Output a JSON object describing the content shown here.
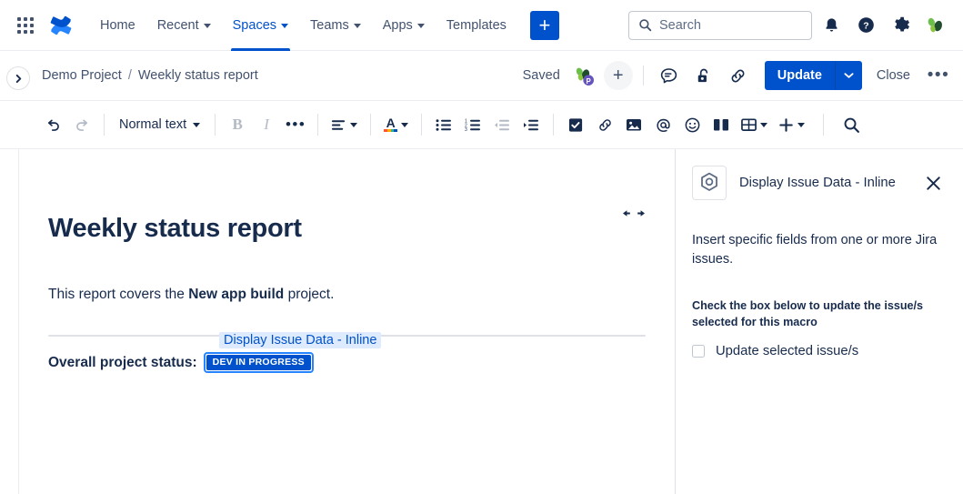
{
  "topnav": {
    "app_switcher_icon": "apps-grid-icon",
    "product_logo_icon": "confluence-logo-icon",
    "items": [
      {
        "label": "Home",
        "has_caret": false,
        "active": false
      },
      {
        "label": "Recent",
        "has_caret": true,
        "active": false
      },
      {
        "label": "Spaces",
        "has_caret": true,
        "active": true
      },
      {
        "label": "Teams",
        "has_caret": true,
        "active": false
      },
      {
        "label": "Apps",
        "has_caret": true,
        "active": false
      },
      {
        "label": "Templates",
        "has_caret": false,
        "active": false
      }
    ],
    "create_button_label": "+",
    "search": {
      "placeholder": "Search",
      "value": "",
      "icon": "search-icon"
    },
    "right_icons": [
      "notifications-bell-icon",
      "help-question-icon",
      "settings-gear-icon"
    ],
    "profile_avatar_icon": "user-avatar-icon"
  },
  "pagebar": {
    "expand_sidebar_icon": "chevron-right-icon",
    "breadcrumb": {
      "space": "Demo Project",
      "separator": "/",
      "page": "Weekly status report"
    },
    "saved_status": "Saved",
    "collaborator_avatar_icon": "collaborator-avatar-icon",
    "add_collaborator_label": "+",
    "comment_icon": "comment-icon",
    "restrictions_icon": "unlocked-padlock-icon",
    "copy_link_icon": "link-chain-icon",
    "update_label": "Update",
    "update_caret_icon": "chevron-down-icon",
    "close_label": "Close",
    "more_label": "•••"
  },
  "toolbar": {
    "undo_icon": "undo-arrow-icon",
    "redo_icon": "redo-arrow-icon",
    "text_style_label": "Normal text",
    "bold_label": "B",
    "italic_label": "I",
    "more_formatting_label": "•••",
    "alignment_icon": "text-align-icon",
    "text_color_label": "A",
    "bullet_list_icon": "bullet-list-icon",
    "numbered_list_icon": "numbered-list-icon",
    "outdent_icon": "outdent-icon",
    "indent_icon": "indent-icon",
    "task_icon": "checkbox-task-icon",
    "link_icon": "link-chain-icon",
    "image_icon": "image-icon",
    "mention_icon": "mention-at-icon",
    "emoji_icon": "emoji-smiley-icon",
    "layout_icon": "page-layout-icon",
    "table_icon": "table-icon",
    "table_caret_icon": "chevron-down-icon",
    "insert_icon": "plus-icon",
    "insert_caret_icon": "chevron-down-icon",
    "find_icon": "search-icon"
  },
  "document": {
    "resize_handle_icon": "horizontal-resize-arrows-icon",
    "title": "Weekly status report",
    "paragraph_before": "This report covers the ",
    "paragraph_bold": "New app build",
    "paragraph_after": " project.",
    "macro_label": "Display Issue Data - Inline",
    "status_prefix": "Overall project status:",
    "status_badge": "DEV IN PROGRESS"
  },
  "sidepanel": {
    "macro_icon": "macro-hex-icon",
    "title": "Display Issue Data - Inline",
    "close_icon": "close-x-icon",
    "description": "Insert specific fields from one or more Jira issues.",
    "note": "Check the box below to update the issue/s selected for this macro",
    "checkbox_label": "Update selected issue/s",
    "checkbox_checked": false
  },
  "colors": {
    "brand_blue": "#0052CC",
    "accent_blue": "#2684FF",
    "macro_label_bg": "#DEEBFF",
    "text_primary": "#172B4D",
    "text_subtle": "#42526E",
    "border": "#DFE1E6"
  }
}
